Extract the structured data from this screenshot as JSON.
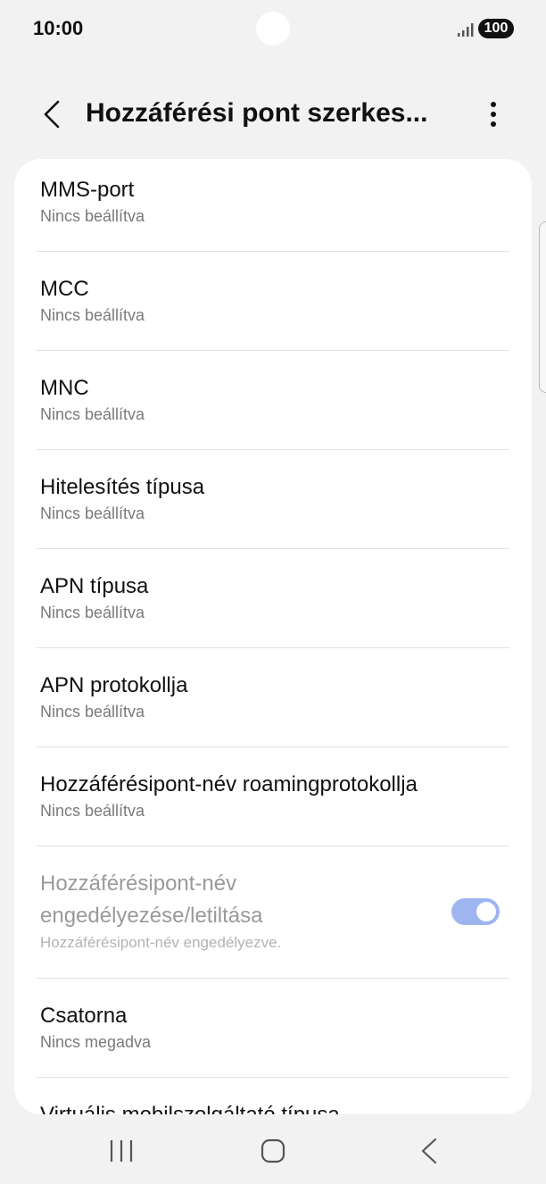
{
  "status_bar": {
    "time": "10:00",
    "battery": "100"
  },
  "header": {
    "title": "Hozzáférési pont szerkes..."
  },
  "items": [
    {
      "title": "MMS-port",
      "subtitle": "Nincs beállítva"
    },
    {
      "title": "MCC",
      "subtitle": "Nincs beállítva"
    },
    {
      "title": "MNC",
      "subtitle": "Nincs beállítva"
    },
    {
      "title": "Hitelesítés típusa",
      "subtitle": "Nincs beállítva"
    },
    {
      "title": "APN típusa",
      "subtitle": "Nincs beállítva"
    },
    {
      "title": "APN protokollja",
      "subtitle": "Nincs beállítva"
    },
    {
      "title": "Hozzáférésipont-név roamingprotokollja",
      "subtitle": "Nincs beállítva"
    },
    {
      "title_line1": "Hozzáférésipont-név",
      "title_line2": "engedélyezése/letiltása",
      "subtitle": "Hozzáférésipont-név engedélyezve.",
      "toggle_on": true,
      "disabled": true
    },
    {
      "title": "Csatorna",
      "subtitle": "Nincs megadva"
    },
    {
      "title": "Virtuális mobilszolgáltató típusa"
    }
  ],
  "colors": {
    "toggle_track": "#9fb5f0",
    "background": "#f2f2f2",
    "card": "#ffffff"
  }
}
